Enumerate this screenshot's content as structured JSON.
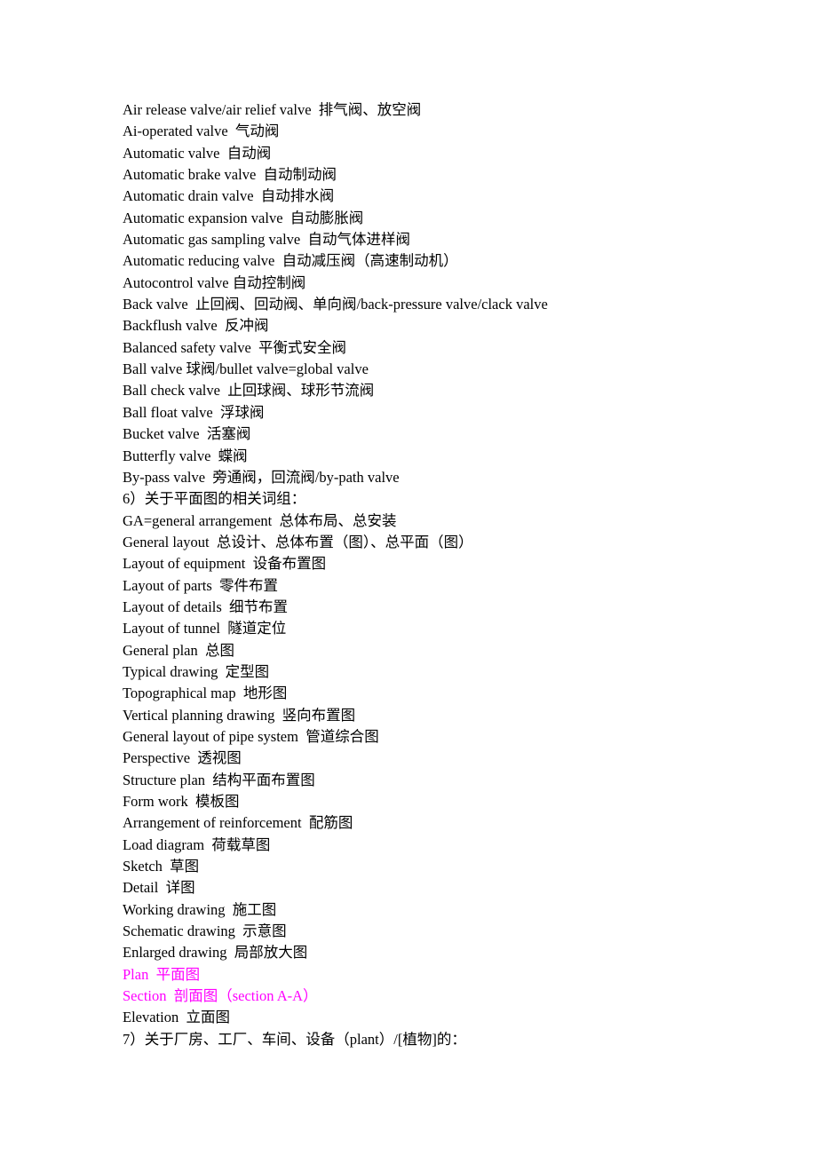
{
  "document": {
    "page_background": "#ffffff",
    "text_color": "#000000",
    "highlight_color": "#ff00ff",
    "lines": [
      {
        "text": "Air release valve/air relief valve  排气阀、放空阀",
        "color": "default"
      },
      {
        "text": "Ai-operated valve  气动阀",
        "color": "default"
      },
      {
        "text": "Automatic valve  自动阀",
        "color": "default"
      },
      {
        "text": "Automatic brake valve  自动制动阀",
        "color": "default"
      },
      {
        "text": "Automatic drain valve  自动排水阀",
        "color": "default"
      },
      {
        "text": "Automatic expansion valve  自动膨胀阀",
        "color": "default"
      },
      {
        "text": "Automatic gas sampling valve  自动气体进样阀",
        "color": "default"
      },
      {
        "text": "Automatic reducing valve  自动减压阀（高速制动机）",
        "color": "default"
      },
      {
        "text": "Autocontrol valve 自动控制阀",
        "color": "default"
      },
      {
        "text": "Back valve  止回阀、回动阀、单向阀/back-pressure valve/clack valve",
        "color": "default"
      },
      {
        "text": "Backflush valve  反冲阀",
        "color": "default"
      },
      {
        "text": "Balanced safety valve  平衡式安全阀",
        "color": "default"
      },
      {
        "text": "Ball valve 球阀/bullet valve=global valve",
        "color": "default"
      },
      {
        "text": "Ball check valve  止回球阀、球形节流阀",
        "color": "default"
      },
      {
        "text": "Ball float valve  浮球阀",
        "color": "default"
      },
      {
        "text": "Bucket valve  活塞阀",
        "color": "default"
      },
      {
        "text": "Butterfly valve  蝶阀",
        "color": "default"
      },
      {
        "text": "By-pass valve  旁通阀，回流阀/by-path valve",
        "color": "default"
      },
      {
        "text": "6）关于平面图的相关词组：",
        "color": "default"
      },
      {
        "text": "GA=general arrangement  总体布局、总安装",
        "color": "default"
      },
      {
        "text": "General layout  总设计、总体布置（图）、总平面（图）",
        "color": "default"
      },
      {
        "text": "Layout of equipment  设备布置图",
        "color": "default"
      },
      {
        "text": "Layout of parts  零件布置",
        "color": "default"
      },
      {
        "text": "Layout of details  细节布置",
        "color": "default"
      },
      {
        "text": "Layout of tunnel  隧道定位",
        "color": "default"
      },
      {
        "text": "General plan  总图",
        "color": "default"
      },
      {
        "text": "Typical drawing  定型图",
        "color": "default"
      },
      {
        "text": "Topographical map  地形图",
        "color": "default"
      },
      {
        "text": "Vertical planning drawing  竖向布置图",
        "color": "default"
      },
      {
        "text": "General layout of pipe system  管道综合图",
        "color": "default"
      },
      {
        "text": "Perspective  透视图",
        "color": "default"
      },
      {
        "text": "Structure plan  结构平面布置图",
        "color": "default"
      },
      {
        "text": "Form work  模板图",
        "color": "default"
      },
      {
        "text": "Arrangement of reinforcement  配筋图",
        "color": "default"
      },
      {
        "text": "Load diagram  荷载草图",
        "color": "default"
      },
      {
        "text": "Sketch  草图",
        "color": "default"
      },
      {
        "text": "Detail  详图",
        "color": "default"
      },
      {
        "text": "Working drawing  施工图",
        "color": "default"
      },
      {
        "text": "Schematic drawing  示意图",
        "color": "default"
      },
      {
        "text": "Enlarged drawing  局部放大图",
        "color": "default"
      },
      {
        "text": "Plan  平面图",
        "color": "highlight"
      },
      {
        "text": "Section  剖面图（section A-A）",
        "color": "highlight"
      },
      {
        "text": "Elevation  立面图",
        "color": "default"
      },
      {
        "text": "7）关于厂房、工厂、车间、设备（plant）/[植物]的：",
        "color": "default"
      }
    ]
  }
}
